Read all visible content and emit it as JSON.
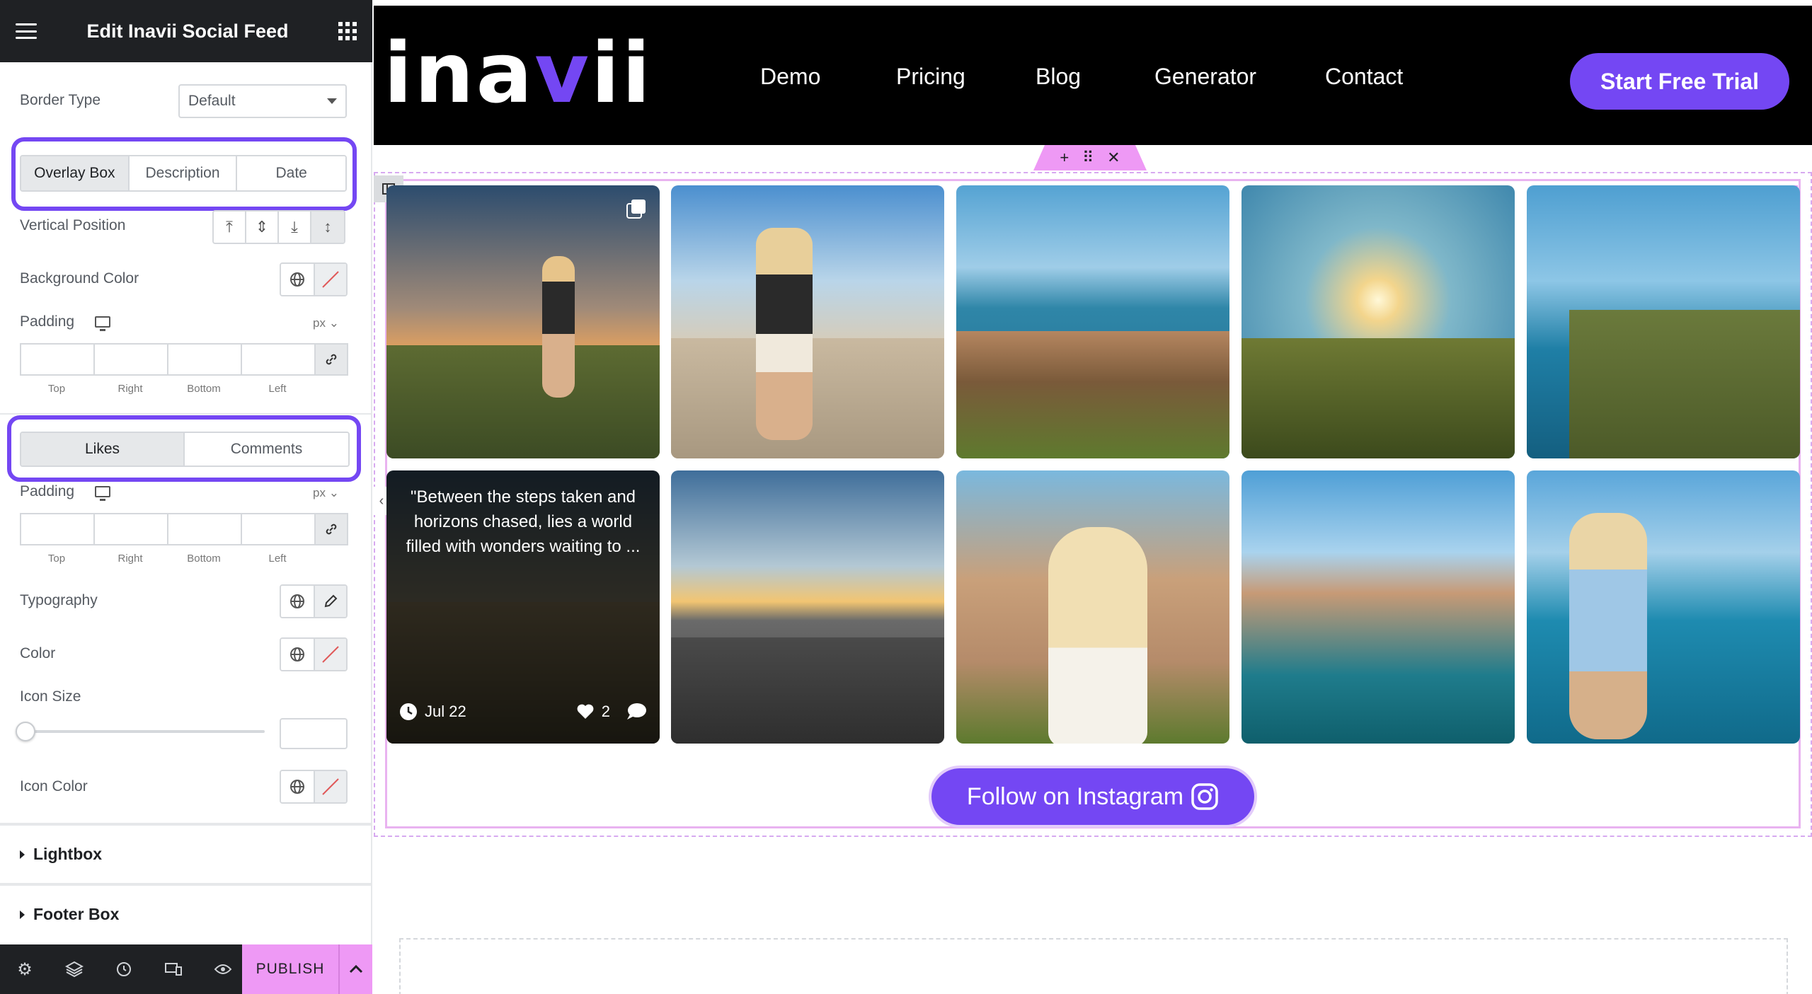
{
  "editor": {
    "title": "Edit Inavii Social Feed",
    "border_type": {
      "label": "Border Type",
      "value": "Default"
    },
    "tabs_overlay": [
      "Overlay Box",
      "Description",
      "Date"
    ],
    "vertical_position": {
      "label": "Vertical Position"
    },
    "background_color": {
      "label": "Background Color"
    },
    "padding1": {
      "label": "Padding",
      "unit": "px",
      "sides": [
        "Top",
        "Right",
        "Bottom",
        "Left"
      ]
    },
    "tabs_likes": [
      "Likes",
      "Comments"
    ],
    "padding2": {
      "label": "Padding",
      "unit": "px",
      "sides": [
        "Top",
        "Right",
        "Bottom",
        "Left"
      ]
    },
    "typography": {
      "label": "Typography"
    },
    "color": {
      "label": "Color"
    },
    "icon_size": {
      "label": "Icon Size",
      "value": 0
    },
    "icon_color": {
      "label": "Icon Color"
    },
    "sections": {
      "lightbox": "Lightbox",
      "footer_box": "Footer Box"
    },
    "footer": {
      "publish": "PUBLISH"
    }
  },
  "site": {
    "logo_prefix": "ina",
    "logo_v": "v",
    "logo_suffix": "ii",
    "nav": [
      "Demo",
      "Pricing",
      "Blog",
      "Generator",
      "Contact"
    ],
    "cta": "Start Free Trial"
  },
  "feed": {
    "post_description": "\"Between the steps taken and horizons chased, lies a world filled with wonders waiting to ...",
    "post_date": "Jul 22",
    "post_likes": "2",
    "follow_button": "Follow on Instagram"
  },
  "colors": {
    "accent": "#7447f3",
    "editor_pink": "#ee99f5",
    "editor_dark": "#1f2124"
  }
}
